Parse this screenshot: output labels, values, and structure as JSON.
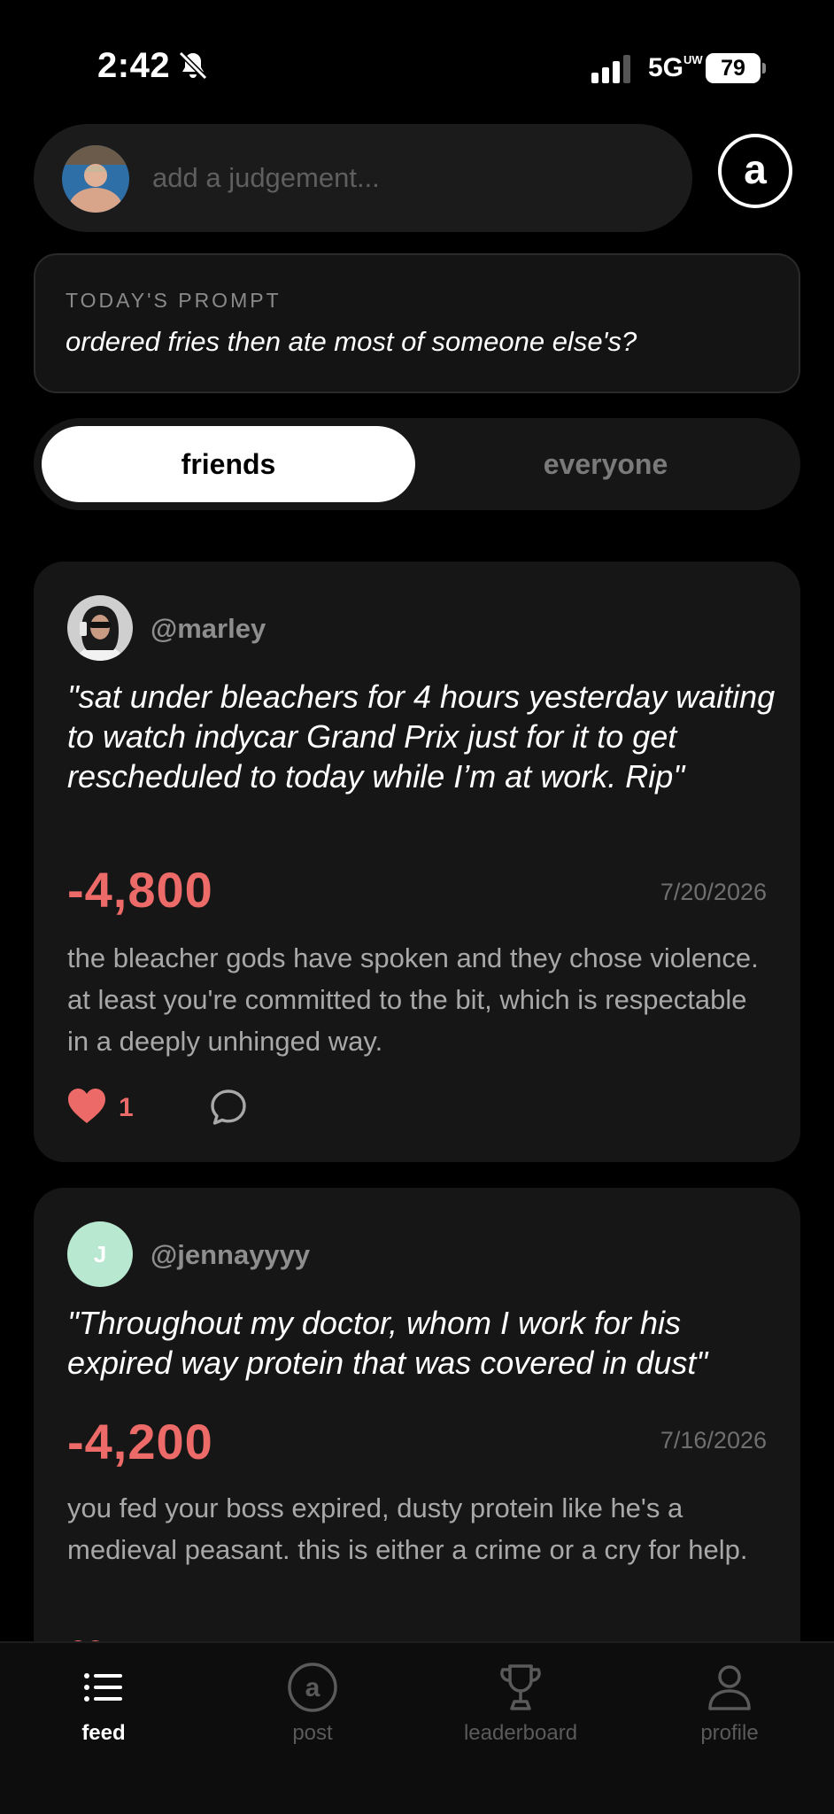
{
  "status_bar": {
    "time": "2:42",
    "network": "5G",
    "network_sub": "UW",
    "battery": "79"
  },
  "composer": {
    "placeholder": "add a judgement...",
    "logo_letter": "a"
  },
  "prompt": {
    "label": "TODAY'S PROMPT",
    "text": "ordered fries then ate most of someone else's?"
  },
  "tabs": [
    {
      "label": "friends",
      "active": true
    },
    {
      "label": "everyone",
      "active": false
    }
  ],
  "posts": [
    {
      "username": "@marley",
      "quote": "\"sat under bleachers for 4 hours yesterday waiting to watch indycar Grand Prix just for it to get rescheduled to today while I’m at work. Rip\"",
      "score": "-4,800",
      "date": "7/20/2026",
      "comment": "the bleacher gods have spoken and they chose violence. at least you're committed to the bit, which is respectable in a deeply unhinged way.",
      "likes": "1"
    },
    {
      "username": "@jennayyyy",
      "avatar_initial": "J",
      "quote": "\"Throughout my doctor, whom I work for his expired way protein that was covered in dust\"",
      "score": "-4,200",
      "date": "7/16/2026",
      "comment": "you fed your boss expired, dusty protein like he's a medieval peasant. this is either a crime or a cry for help."
    }
  ],
  "nav": [
    {
      "label": "feed",
      "icon": "list-icon",
      "active": true
    },
    {
      "label": "post",
      "icon": "logo-circle-icon",
      "active": false
    },
    {
      "label": "leaderboard",
      "icon": "trophy-icon",
      "active": false
    },
    {
      "label": "profile",
      "icon": "person-icon",
      "active": false
    }
  ],
  "colors": {
    "background": "#000000",
    "card": "#161616",
    "score": "#ec6a68",
    "avatar_initial_bg": "#b9e8d1"
  }
}
